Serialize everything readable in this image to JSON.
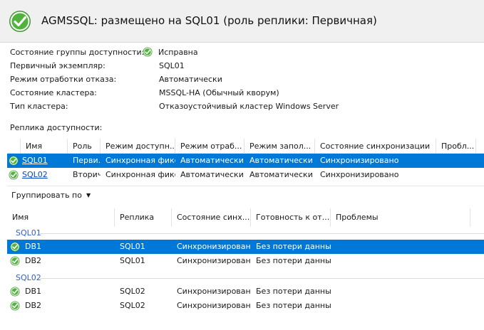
{
  "header": {
    "title": "AGMSSQL: размещено на SQL01 (роль реплики: Первичная)"
  },
  "properties": [
    {
      "label": "Состояние группы доступности:",
      "value": "Исправна",
      "icon": "check-circle-icon"
    },
    {
      "label": "Первичный экземпляр:",
      "value": "SQL01"
    },
    {
      "label": "Режим отработки отказа:",
      "value": "Автоматически"
    },
    {
      "label": "Состояние кластера:",
      "value": "MSSQL-HA (Обычный кворум)"
    },
    {
      "label": "Тип кластера:",
      "value": "Отказоустойчивый кластер Windows Server"
    }
  ],
  "replicas": {
    "section_label": "Реплика доступности:",
    "columns": [
      "Имя",
      "Роль",
      "Режим доступн...",
      "Режим отраб...",
      "Режим запол...",
      "Состояние синхронизации",
      "Пробл..."
    ],
    "rows": [
      {
        "name": "SQL01",
        "role": "Перви...",
        "availability_mode": "Синхронная фикс...",
        "failover_mode": "Автоматически",
        "seeding_mode": "Автоматически",
        "sync_state": "Синхронизировано",
        "issues": "",
        "selected": true
      },
      {
        "name": "SQL02",
        "role": "Вторич...",
        "availability_mode": "Синхронная фикс...",
        "failover_mode": "Автоматически",
        "seeding_mode": "Автоматически",
        "sync_state": "Синхронизировано",
        "issues": "",
        "selected": false
      }
    ]
  },
  "databases": {
    "group_by_label": "Группировать по",
    "columns": [
      "Имя",
      "Реплика",
      "Состояние синх...",
      "Готовность к от...",
      "Проблемы"
    ],
    "groups": [
      {
        "name": "SQL01",
        "rows": [
          {
            "name": "DB1",
            "replica": "SQL01",
            "sync_state": "Синхронизировано",
            "failover_readiness": "Без потери данных",
            "issues": "",
            "selected": true
          },
          {
            "name": "DB2",
            "replica": "SQL01",
            "sync_state": "Синхронизировано",
            "failover_readiness": "Без потери данных",
            "issues": "",
            "selected": false
          }
        ]
      },
      {
        "name": "SQL02",
        "rows": [
          {
            "name": "DB1",
            "replica": "SQL02",
            "sync_state": "Синхронизировано",
            "failover_readiness": "Без потери данных",
            "issues": "",
            "selected": false
          },
          {
            "name": "DB2",
            "replica": "SQL02",
            "sync_state": "Синхронизировано",
            "failover_readiness": "Без потери данных",
            "issues": "",
            "selected": false
          }
        ]
      }
    ]
  },
  "colors": {
    "selection": "#0078d7",
    "healthy_green": "#3c9a2e",
    "link": "#0645c8",
    "group_header": "#2f5fc0"
  }
}
